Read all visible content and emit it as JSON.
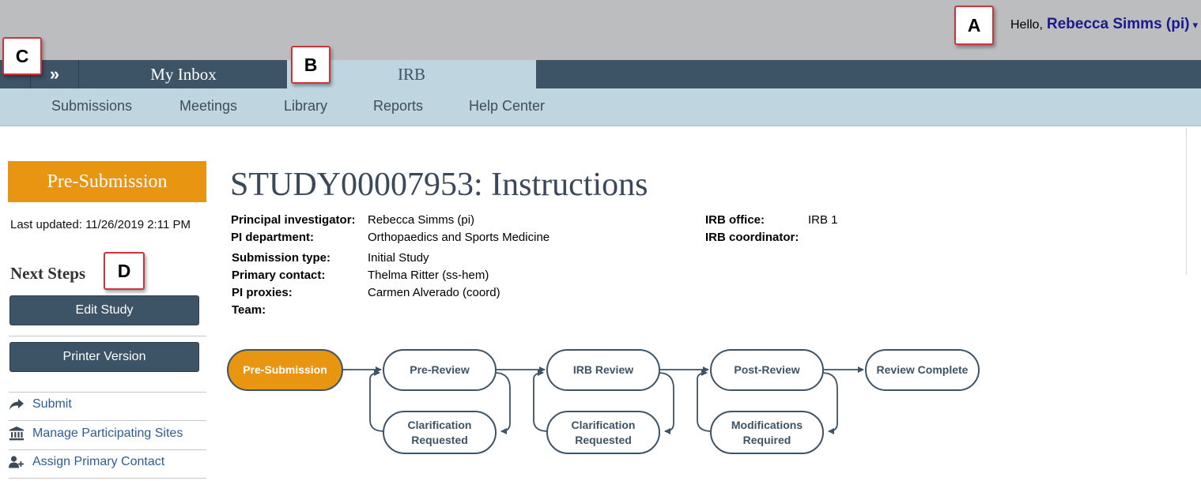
{
  "header": {
    "greeting": "Hello,",
    "user_name": "Rebecca Simms (pi)",
    "caret": "▾"
  },
  "tabs": {
    "expand_icon": "»",
    "inbox_label": "My Inbox",
    "irb_label": "IRB"
  },
  "sub_nav": [
    "Submissions",
    "Meetings",
    "Library",
    "Reports",
    "Help Center"
  ],
  "markers": [
    "A",
    "B",
    "C",
    "D"
  ],
  "sidebar": {
    "status": "Pre-Submission",
    "status_color": "#e89611",
    "last_updated": "Last updated: 11/26/2019 2:11 PM",
    "next_steps_title": "Next Steps",
    "buttons": [
      "Edit Study",
      "Printer Version"
    ],
    "links": [
      {
        "label": "Submit",
        "icon": "share-arrow-icon"
      },
      {
        "label": "Manage Participating Sites",
        "icon": "institution-icon"
      },
      {
        "label": "Assign Primary Contact",
        "icon": "user-plus-icon"
      }
    ]
  },
  "main": {
    "title": "STUDY00007953: Instructions",
    "details_left": [
      {
        "label": "Principal investigator:",
        "value": "Rebecca Simms (pi)"
      },
      {
        "label": "PI department:",
        "value": "Orthopaedics and Sports Medicine"
      },
      {
        "label": "Submission type:",
        "value": "Initial Study"
      },
      {
        "label": "Primary contact:",
        "value": "Thelma Ritter (ss-hem)"
      },
      {
        "label": "PI proxies:",
        "value": "Carmen Alverado (coord)"
      },
      {
        "label": "Team:",
        "value": ""
      }
    ],
    "details_right": [
      {
        "label": "IRB office:",
        "value": "IRB 1"
      },
      {
        "label": "IRB coordinator:",
        "value": ""
      }
    ]
  },
  "workflow": {
    "active_color": "#e89611",
    "node_stroke": "#3d5366",
    "main_nodes": [
      "Pre-Submission",
      "Pre-Review",
      "IRB Review",
      "Post-Review",
      "Review Complete"
    ],
    "loop_nodes": [
      [
        "Clarification",
        "Requested"
      ],
      [
        "Clarification",
        "Requested"
      ],
      [
        "Modifications",
        "Required"
      ]
    ]
  }
}
